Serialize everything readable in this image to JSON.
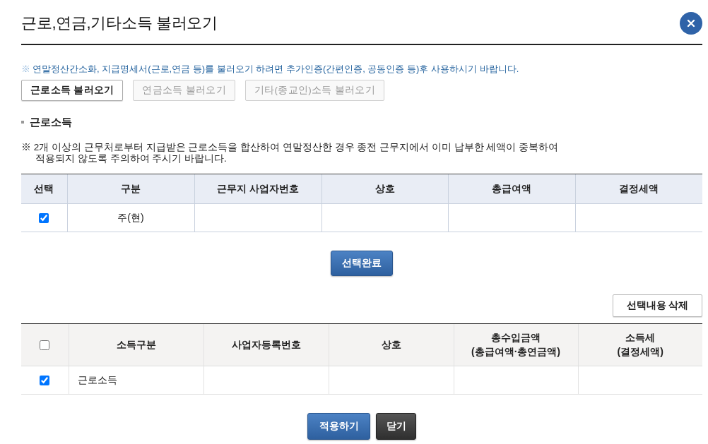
{
  "dialog": {
    "title": "근로,연금,기타소득 불러오기"
  },
  "notice": {
    "symbol": "※",
    "text": "연말정산간소화, 지급명세서(근로,연금 등)를 불러오기 하려면 추가인증(간편인증, 공동인증 등)후 사용하시기 바랍니다."
  },
  "load_buttons": [
    {
      "label": "근로소득 불러오기",
      "disabled": false
    },
    {
      "label": "연금소득 불러오기",
      "disabled": true
    },
    {
      "label": "기타(종교인)소득 불러오기",
      "disabled": true
    }
  ],
  "section": {
    "heading": "근로소득",
    "note": "※ 2개 이상의 근무처로부터 지급받은 근로소득을 합산하여 연말정산한 경우 종전 근무지에서 이미 납부한 세액이 중복하여\n적용되지 않도록 주의하여 주시기 바랍니다."
  },
  "workplace_table": {
    "columns": [
      "선택",
      "구분",
      "근무지 사업자번호",
      "상호",
      "총급여액",
      "결정세액"
    ],
    "rows": [
      {
        "checked": true,
        "type": "주(현)"
      }
    ]
  },
  "complete_button": "선택완료",
  "delete_button": "선택내용 삭제",
  "income_table": {
    "all_checked": false,
    "columns": [
      "소득구분",
      "사업자등록번호",
      "상호",
      "총수입금액\n(총급여액·총연금액)",
      "소득세\n(결정세액)"
    ],
    "rows": [
      {
        "checked": true,
        "income_type": "근로소득"
      }
    ]
  },
  "footer_buttons": [
    {
      "label": "적용하기",
      "kind": "primary"
    },
    {
      "label": "닫기",
      "kind": "dark"
    }
  ]
}
